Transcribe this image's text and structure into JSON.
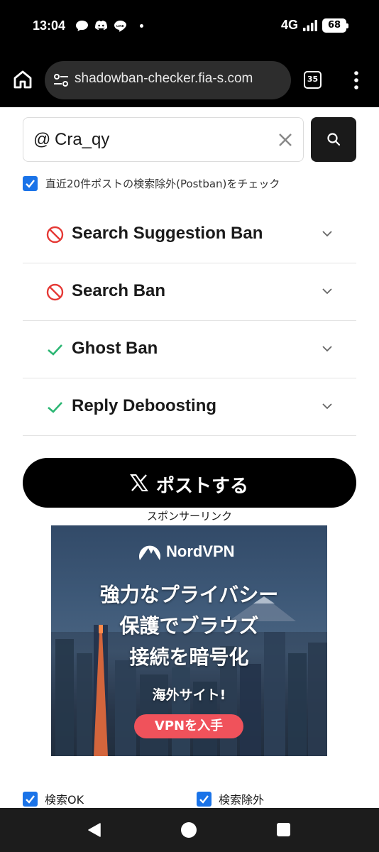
{
  "status_bar": {
    "time": "13:04",
    "network": "4G",
    "battery": "68",
    "icons": [
      "chat-bubble-icon",
      "discord-icon",
      "line-icon",
      "dot-icon",
      "signal-icon",
      "battery-icon"
    ]
  },
  "browser": {
    "url": "shadowban-checker.fia-s.com",
    "tab_count": "35",
    "icons": [
      "home-icon",
      "site-info-icon",
      "tabs-icon",
      "menu-icon"
    ]
  },
  "search": {
    "prefix": "@",
    "value": "Cra_qy"
  },
  "postban_check": {
    "label": "直近20件ポストの検索除外(Postban)をチェック",
    "checked": true
  },
  "results": [
    {
      "label": "Search Suggestion Ban",
      "status": "banned"
    },
    {
      "label": "Search Ban",
      "status": "banned"
    },
    {
      "label": "Ghost Ban",
      "status": "ok"
    },
    {
      "label": "Reply Deboosting",
      "status": "ok"
    }
  ],
  "post_button": {
    "label": "ポストする"
  },
  "sponsor": {
    "label": "スポンサーリンク"
  },
  "ad": {
    "brand": "NordVPN",
    "line1": "強力なプライバシー",
    "line2": "保護でブラウズ",
    "line3": "接続を暗号化",
    "sub": "海外サイト!",
    "cta": "VPNを入手"
  },
  "filters": [
    {
      "label": "検索OK",
      "checked": true
    },
    {
      "label": "検索除外",
      "checked": true
    }
  ],
  "colors": {
    "accent": "#1a73e8",
    "ban": "#e53935",
    "ok": "#2bb673",
    "cta": "#f0525b"
  }
}
